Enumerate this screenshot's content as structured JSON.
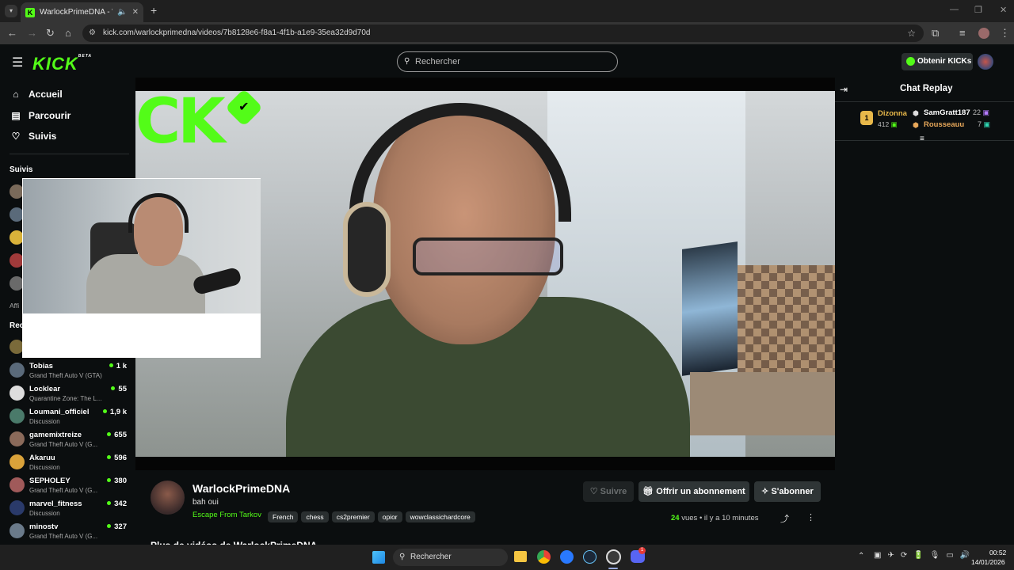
{
  "browser": {
    "tab_title": "WarlockPrimeDNA - Watch",
    "new_tab": "+",
    "url": "kick.com/warlockprimedna/videos/7b8128e6-f8a1-4f1b-a1e9-35ea32d9d70d"
  },
  "header": {
    "logo": "KICK",
    "logo_badge": "BETA",
    "search_placeholder": "Rechercher",
    "get_kicks": "Obtenir KICKs"
  },
  "sidebar": {
    "nav": [
      {
        "label": "Accueil",
        "icon": "home-icon"
      },
      {
        "label": "Parcourir",
        "icon": "browse-icon"
      },
      {
        "label": "Suivis",
        "icon": "heart-icon"
      }
    ],
    "following_title": "Suivis",
    "show_more": "Affi",
    "recommended_title": "Rec",
    "channels": [
      {
        "name": "Tobias",
        "game": "Grand Theft Auto V (GTA)",
        "viewers": "1 k",
        "color": "#5a6a7a"
      },
      {
        "name": "Locklear",
        "game": "Quarantine Zone: The L...",
        "viewers": "55",
        "color": "#dddddd"
      },
      {
        "name": "Loumani_officiel",
        "game": "Discussion",
        "viewers": "1,9 k",
        "color": "#4a7a6a"
      },
      {
        "name": "gamemixtreize",
        "game": "Grand Theft Auto V (G...",
        "viewers": "655",
        "color": "#8a6a5a"
      },
      {
        "name": "Akaruu",
        "game": "Discussion",
        "viewers": "596",
        "color": "#d9a23a"
      },
      {
        "name": "SEPHOLEY",
        "game": "Grand Theft Auto V (G...",
        "viewers": "380",
        "color": "#a05a5a"
      },
      {
        "name": "marvel_fitness",
        "game": "Discussion",
        "viewers": "342",
        "color": "#2a3a6a"
      },
      {
        "name": "minostv",
        "game": "Grand Theft Auto V (G...",
        "viewers": "327",
        "color": "#6a7a8a"
      }
    ]
  },
  "video": {
    "watermark": "CK"
  },
  "info": {
    "channel_name": "WarlockPrimeDNA",
    "title": "bah oui",
    "category": "Escape From Tarkov",
    "tags": [
      "French",
      "chess",
      "cs2premier",
      "opior",
      "wowclassichardcore"
    ],
    "follow_label": "Suivre",
    "gift_label": "Offrir un abonnement",
    "subscribe_label": "S'abonner",
    "views_count": "24",
    "views_label": "vues",
    "time_ago": "il y a 10 minutes",
    "more_videos": "Plus de vidéos de WarlockPrimeDNA"
  },
  "chat": {
    "title": "Chat Replay",
    "leaders": [
      {
        "rank": "1",
        "name": "Dizonna",
        "value": "412",
        "color": "#e8b84a"
      },
      {
        "name": "SamGratt187",
        "value": "22",
        "color": "#ffffff"
      },
      {
        "name": "Rousseauu",
        "value": "7",
        "color": "#e8a85a"
      }
    ]
  },
  "taskbar": {
    "search": "Rechercher",
    "time": "00:52",
    "date": "14/01/2026",
    "discord_badge": "1"
  }
}
